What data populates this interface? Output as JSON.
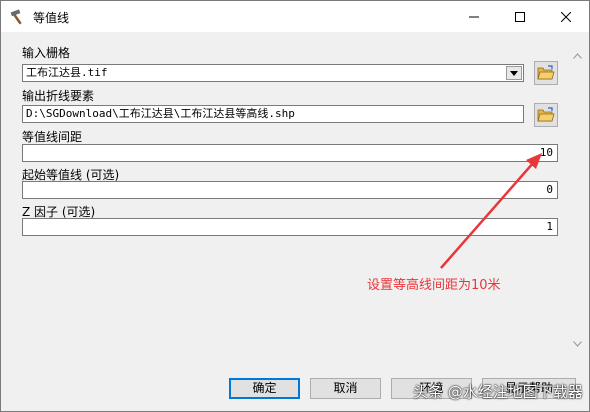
{
  "window": {
    "title": "等值线",
    "icon": "hammer-tool-icon"
  },
  "fields": {
    "input_raster": {
      "label": "输入栅格",
      "value": "工布江达县.tif"
    },
    "output_polyline": {
      "label": "输出折线要素",
      "value": "D:\\SGDownload\\工布江达县\\工布江达县等高线.shp"
    },
    "contour_interval": {
      "label": "等值线间距",
      "value": "10"
    },
    "base_contour": {
      "label": "起始等值线 (可选)",
      "value": "0"
    },
    "z_factor": {
      "label": "Z 因子 (可选)",
      "value": "1"
    }
  },
  "annotation": {
    "text": "设置等高线间距为10米",
    "color": "#e8363a"
  },
  "buttons": {
    "ok": "确定",
    "cancel": "取消",
    "env": "环境",
    "help": "显示帮助"
  },
  "watermark": "头条 @水经注地图下载器",
  "colors": {
    "accent": "#0078d7",
    "annotation": "#e8363a",
    "folder": "#e8b44c"
  }
}
